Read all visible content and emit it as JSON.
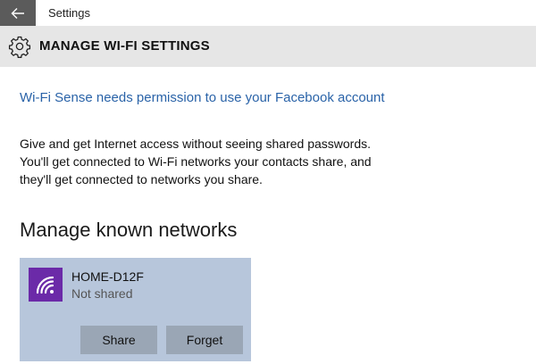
{
  "titlebar": {
    "app_title": "Settings"
  },
  "header": {
    "title": "MANAGE WI-FI SETTINGS"
  },
  "main": {
    "permission_link": "Wi-Fi Sense needs permission to use your Facebook account",
    "description_lines": [
      "Give and get Internet access without seeing shared passwords.",
      "You'll get connected to Wi-Fi networks your contacts share, and",
      "they'll get connected to networks you share."
    ],
    "section_title": "Manage known networks",
    "networks": [
      {
        "name": "HOME-D12F",
        "status": "Not shared",
        "icon": "wifi-icon",
        "share_label": "Share",
        "forget_label": "Forget"
      }
    ]
  },
  "colors": {
    "back_button": "#5b5b5b",
    "header_bg": "#e6e6e6",
    "link": "#2a63a8",
    "network_card": "#b7c6db",
    "wifi_tile": "#6b2aa8",
    "button": "#9aa6b5"
  },
  "icons": {
    "back": "back-arrow-icon",
    "settings": "gear-icon",
    "network": "wifi-icon"
  }
}
